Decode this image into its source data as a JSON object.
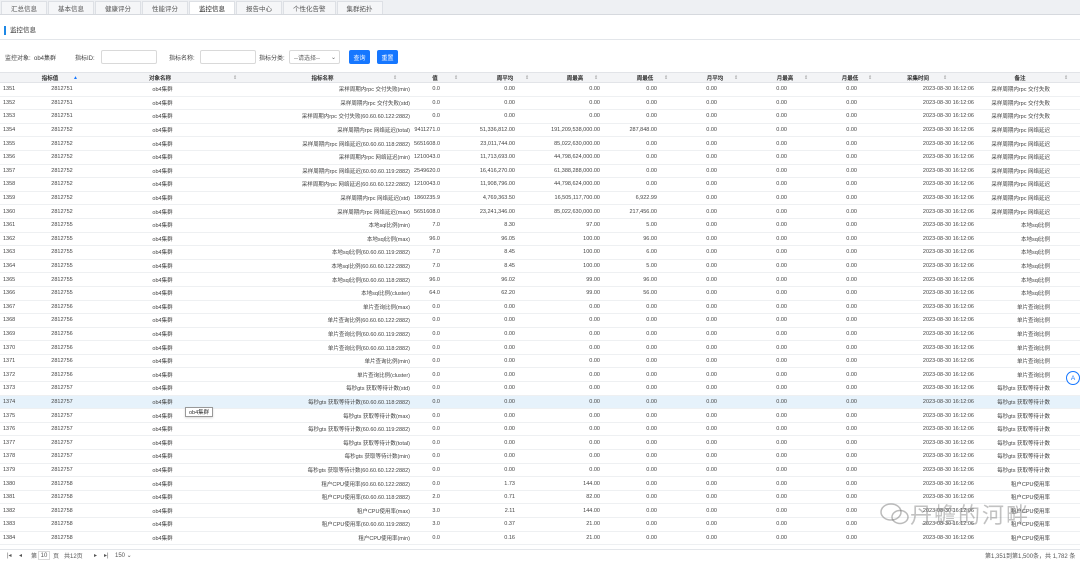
{
  "tabs": [
    {
      "label": "汇总信息",
      "active": false
    },
    {
      "label": "基本信息",
      "active": false
    },
    {
      "label": "健康评分",
      "active": false
    },
    {
      "label": "性能评分",
      "active": false
    },
    {
      "label": "监控信息",
      "active": true
    },
    {
      "label": "报告中心",
      "active": false
    },
    {
      "label": "个性化告警",
      "active": false
    },
    {
      "label": "集群拓扑",
      "active": false
    }
  ],
  "section": {
    "title": "监控信息"
  },
  "filter": {
    "target_label": "监控对象:",
    "target_value": "ob4集群",
    "metric_id_label": "指标ID:",
    "metric_id_value": "",
    "metric_name_label": "指标名称:",
    "metric_name_value": "",
    "category_label": "指标分类:",
    "category_value": "--请选择--",
    "query_button": "查询",
    "reset_button": "重置"
  },
  "columns": [
    "指标值",
    "对象名称",
    "指标名称",
    "值",
    "周平均",
    "周最高",
    "周最低",
    "月平均",
    "月最高",
    "月最低",
    "采集时间",
    "备注"
  ],
  "rows": [
    [
      "1351",
      "2812751",
      "ob4集群",
      "采样周期内rpc 交付失败(min)",
      "0.0",
      "0.00",
      "0.00",
      "0.00",
      "0.00",
      "0.00",
      "0.00",
      "2023-08-30 16:12:06",
      "采样周期内rpc 交付失败"
    ],
    [
      "1352",
      "2812751",
      "ob4集群",
      "采样周期内rpc 交付失败(std)",
      "0.0",
      "0.00",
      "0.00",
      "0.00",
      "0.00",
      "0.00",
      "0.00",
      "2023-08-30 16:12:06",
      "采样周期内rpc 交付失败"
    ],
    [
      "1353",
      "2812751",
      "ob4集群",
      "采样周期内rpc 交付失败(60.60.60.122:2882)",
      "0.0",
      "0.00",
      "0.00",
      "0.00",
      "0.00",
      "0.00",
      "0.00",
      "2023-08-30 16:12:06",
      "采样周期内rpc 交付失败"
    ],
    [
      "1354",
      "2812752",
      "ob4集群",
      "采样周期内rpc 网络延迟(total)",
      "9411271.0",
      "51,336,812.00",
      "191,209,538,000.00",
      "287,848.00",
      "0.00",
      "0.00",
      "0.00",
      "2023-08-30 16:12:06",
      "采样周期内rpc 网络延迟"
    ],
    [
      "1355",
      "2812752",
      "ob4集群",
      "采样周期内rpc 网络延迟(60.60.60.118:2882)",
      "5651608.0",
      "23,011,744.00",
      "85,022,630,000.00",
      "0.00",
      "0.00",
      "0.00",
      "0.00",
      "2023-08-30 16:12:06",
      "采样周期内rpc 网络延迟"
    ],
    [
      "1356",
      "2812752",
      "ob4集群",
      "采样周期内rpc 网络延迟(min)",
      "1210043.0",
      "11,713,693.00",
      "44,798,624,000.00",
      "0.00",
      "0.00",
      "0.00",
      "0.00",
      "2023-08-30 16:12:06",
      "采样周期内rpc 网络延迟"
    ],
    [
      "1357",
      "2812752",
      "ob4集群",
      "采样周期内rpc 网络延迟(60.60.60.119:2882)",
      "2549620.0",
      "16,416,270.00",
      "61,388,288,000.00",
      "0.00",
      "0.00",
      "0.00",
      "0.00",
      "2023-08-30 16:12:06",
      "采样周期内rpc 网络延迟"
    ],
    [
      "1358",
      "2812752",
      "ob4集群",
      "采样周期内rpc 网络延迟(60.60.60.122:2882)",
      "1210043.0",
      "11,908,796.00",
      "44,798,624,000.00",
      "0.00",
      "0.00",
      "0.00",
      "0.00",
      "2023-08-30 16:12:06",
      "采样周期内rpc 网络延迟"
    ],
    [
      "1359",
      "2812752",
      "ob4集群",
      "采样周期内rpc 网络延迟(std)",
      "1860235.9",
      "4,769,363.50",
      "16,505,117,700.00",
      "6,922.99",
      "0.00",
      "0.00",
      "0.00",
      "2023-08-30 16:12:06",
      "采样周期内rpc 网络延迟"
    ],
    [
      "1360",
      "2812752",
      "ob4集群",
      "采样周期内rpc 网络延迟(max)",
      "5651608.0",
      "23,241,346.00",
      "85,022,630,000.00",
      "217,456.00",
      "0.00",
      "0.00",
      "0.00",
      "2023-08-30 16:12:06",
      "采样周期内rpc 网络延迟"
    ],
    [
      "1361",
      "2812755",
      "ob4集群",
      "本地sql比例(min)",
      "7.0",
      "8.30",
      "97.00",
      "5.00",
      "0.00",
      "0.00",
      "0.00",
      "2023-08-30 16:12:06",
      "本地sql比例"
    ],
    [
      "1362",
      "2812755",
      "ob4集群",
      "本地sql比例(max)",
      "96.0",
      "96.05",
      "100.00",
      "96.00",
      "0.00",
      "0.00",
      "0.00",
      "2023-08-30 16:12:06",
      "本地sql比例"
    ],
    [
      "1363",
      "2812755",
      "ob4集群",
      "本地sql比例(60.60.60.119:2882)",
      "7.0",
      "8.45",
      "100.00",
      "6.00",
      "0.00",
      "0.00",
      "0.00",
      "2023-08-30 16:12:06",
      "本地sql比例"
    ],
    [
      "1364",
      "2812755",
      "ob4集群",
      "本地sql比例(60.60.60.122:2882)",
      "7.0",
      "8.45",
      "100.00",
      "5.00",
      "0.00",
      "0.00",
      "0.00",
      "2023-08-30 16:12:06",
      "本地sql比例"
    ],
    [
      "1365",
      "2812755",
      "ob4集群",
      "本地sql比例(60.60.60.118:2882)",
      "96.0",
      "96.02",
      "99.00",
      "96.00",
      "0.00",
      "0.00",
      "0.00",
      "2023-08-30 16:12:06",
      "本地sql比例"
    ],
    [
      "1366",
      "2812755",
      "ob4集群",
      "本地sql比例(cluster)",
      "64.0",
      "62.20",
      "99.00",
      "56.00",
      "0.00",
      "0.00",
      "0.00",
      "2023-08-30 16:12:06",
      "本地sql比例"
    ],
    [
      "1367",
      "2812756",
      "ob4集群",
      "单片查询比例(max)",
      "0.0",
      "0.00",
      "0.00",
      "0.00",
      "0.00",
      "0.00",
      "0.00",
      "2023-08-30 16:12:06",
      "单片查询比例"
    ],
    [
      "1368",
      "2812756",
      "ob4集群",
      "单片查询比例(60.60.60.122:2882)",
      "0.0",
      "0.00",
      "0.00",
      "0.00",
      "0.00",
      "0.00",
      "0.00",
      "2023-08-30 16:12:06",
      "单片查询比例"
    ],
    [
      "1369",
      "2812756",
      "ob4集群",
      "单片查询比例(60.60.60.119:2882)",
      "0.0",
      "0.00",
      "0.00",
      "0.00",
      "0.00",
      "0.00",
      "0.00",
      "2023-08-30 16:12:06",
      "单片查询比例"
    ],
    [
      "1370",
      "2812756",
      "ob4集群",
      "单片查询比例(60.60.60.118:2882)",
      "0.0",
      "0.00",
      "0.00",
      "0.00",
      "0.00",
      "0.00",
      "0.00",
      "2023-08-30 16:12:06",
      "单片查询比例"
    ],
    [
      "1371",
      "2812756",
      "ob4集群",
      "单片查询比例(min)",
      "0.0",
      "0.00",
      "0.00",
      "0.00",
      "0.00",
      "0.00",
      "0.00",
      "2023-08-30 16:12:06",
      "单片查询比例"
    ],
    [
      "1372",
      "2812756",
      "ob4集群",
      "单片查询比例(cluster)",
      "0.0",
      "0.00",
      "0.00",
      "0.00",
      "0.00",
      "0.00",
      "0.00",
      "2023-08-30 16:12:06",
      "单片查询比例"
    ],
    [
      "1373",
      "2812757",
      "ob4集群",
      "每秒gts 获取等待计数(std)",
      "0.0",
      "0.00",
      "0.00",
      "0.00",
      "0.00",
      "0.00",
      "0.00",
      "2023-08-30 16:12:06",
      "每秒gts 获取等待计数"
    ],
    [
      "1374",
      "2812757",
      "ob4集群",
      "每秒gts 获取等待计数(60.60.60.118:2882)",
      "0.0",
      "0.00",
      "0.00",
      "0.00",
      "0.00",
      "0.00",
      "0.00",
      "2023-08-30 16:12:06",
      "每秒gts 获取等待计数"
    ],
    [
      "1375",
      "2812757",
      "ob4集群",
      "每秒gts 获取等待计数(max)",
      "0.0",
      "0.00",
      "0.00",
      "0.00",
      "0.00",
      "0.00",
      "0.00",
      "2023-08-30 16:12:06",
      "每秒gts 获取等待计数"
    ],
    [
      "1376",
      "2812757",
      "ob4集群",
      "每秒gts 获取等待计数(60.60.60.119:2882)",
      "0.0",
      "0.00",
      "0.00",
      "0.00",
      "0.00",
      "0.00",
      "0.00",
      "2023-08-30 16:12:06",
      "每秒gts 获取等待计数"
    ],
    [
      "1377",
      "2812757",
      "ob4集群",
      "每秒gts 获取等待计数(total)",
      "0.0",
      "0.00",
      "0.00",
      "0.00",
      "0.00",
      "0.00",
      "0.00",
      "2023-08-30 16:12:06",
      "每秒gts 获取等待计数"
    ],
    [
      "1378",
      "2812757",
      "ob4集群",
      "每秒gts 获取等待计数(min)",
      "0.0",
      "0.00",
      "0.00",
      "0.00",
      "0.00",
      "0.00",
      "0.00",
      "2023-08-30 16:12:06",
      "每秒gts 获取等待计数"
    ],
    [
      "1379",
      "2812757",
      "ob4集群",
      "每秒gts 获取等待计数(60.60.60.122:2882)",
      "0.0",
      "0.00",
      "0.00",
      "0.00",
      "0.00",
      "0.00",
      "0.00",
      "2023-08-30 16:12:06",
      "每秒gts 获取等待计数"
    ],
    [
      "1380",
      "2812758",
      "ob4集群",
      "租户CPU使用率(60.60.60.122:2882)",
      "0.0",
      "1.73",
      "144.00",
      "0.00",
      "0.00",
      "0.00",
      "0.00",
      "2023-08-30 16:12:06",
      "租户CPU使用率"
    ],
    [
      "1381",
      "2812758",
      "ob4集群",
      "租户CPU使用率(60.60.60.118:2882)",
      "2.0",
      "0.71",
      "82.00",
      "0.00",
      "0.00",
      "0.00",
      "0.00",
      "2023-08-30 16:12:06",
      "租户CPU使用率"
    ],
    [
      "1382",
      "2812758",
      "ob4集群",
      "租户CPU使用率(max)",
      "3.0",
      "2.11",
      "144.00",
      "0.00",
      "0.00",
      "0.00",
      "0.00",
      "2023-08-30 16:12:06",
      "租户CPU使用率"
    ],
    [
      "1383",
      "2812758",
      "ob4集群",
      "租户CPU使用率(60.60.60.119:2882)",
      "3.0",
      "0.37",
      "21.00",
      "0.00",
      "0.00",
      "0.00",
      "0.00",
      "2023-08-30 16:12:06",
      "租户CPU使用率"
    ],
    [
      "1384",
      "2812758",
      "ob4集群",
      "租户CPU使用率(min)",
      "0.0",
      "0.16",
      "21.00",
      "0.00",
      "0.00",
      "0.00",
      "0.00",
      "2023-08-30 16:12:06",
      "租户CPU使用率"
    ]
  ],
  "highlight_row": 23,
  "tooltip": "ob4集群",
  "pager": {
    "page_label": "第",
    "page_value": "10",
    "page_suffix": "页",
    "total_pages": "共12页",
    "page_size": "150",
    "summary": "第1,351到第1,500条，共 1,782 条"
  },
  "float_button": "A",
  "watermark": "丹蟾的河畔",
  "colors": {
    "accent": "#1677ff",
    "highlight": "#e6f2fb",
    "header_bg": "#f3f4f6"
  }
}
